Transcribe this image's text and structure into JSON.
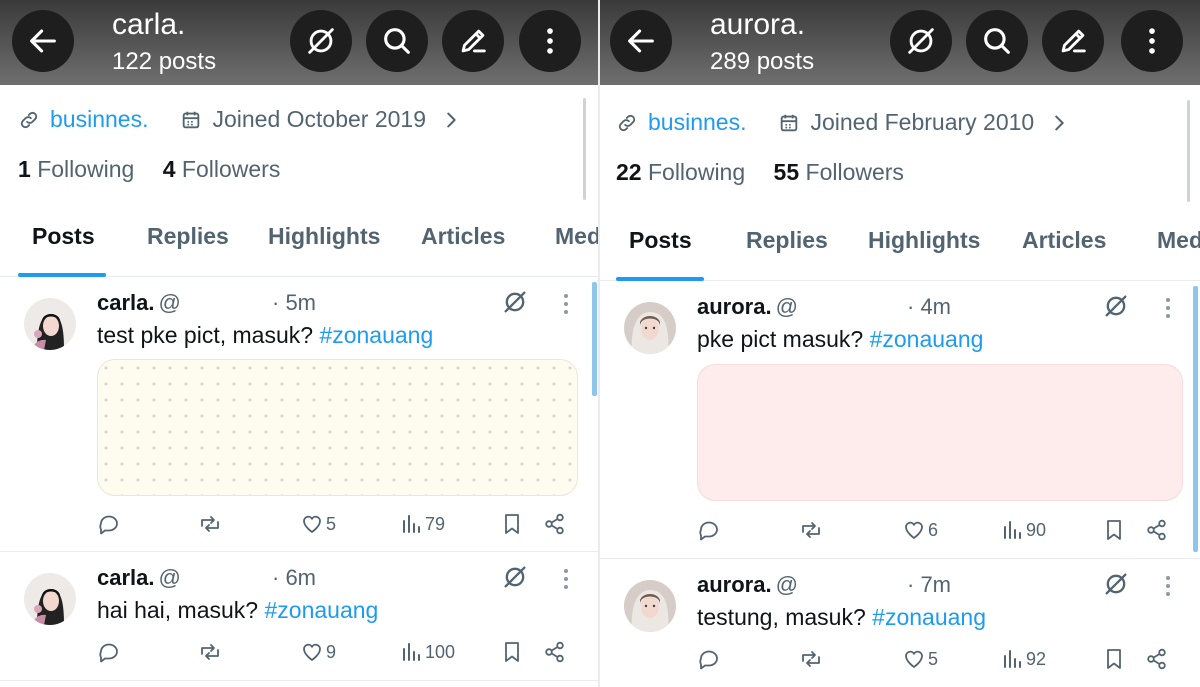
{
  "left": {
    "title": "carla.",
    "post_count": "122 posts",
    "link": "businnes.",
    "joined": "Joined October 2019",
    "following_count": "1",
    "following_label": "Following",
    "followers_count": "4",
    "followers_label": "Followers",
    "tabs": [
      "Posts",
      "Replies",
      "Highlights",
      "Articles",
      "Med"
    ],
    "posts": [
      {
        "name": "carla.",
        "handle": "@",
        "time": "· 5m",
        "text": "test pke pict, masuk?",
        "hashtag": "#zonauang",
        "likes": "5",
        "views": "79"
      },
      {
        "name": "carla.",
        "handle": "@",
        "time": "· 6m",
        "text": "hai hai, masuk?",
        "hashtag": "#zonauang",
        "likes": "9",
        "views": "100"
      }
    ]
  },
  "right": {
    "title": "aurora.",
    "post_count": "289 posts",
    "link": "businnes.",
    "joined": "Joined February 2010",
    "following_count": "22",
    "following_label": "Following",
    "followers_count": "55",
    "followers_label": "Followers",
    "tabs": [
      "Posts",
      "Replies",
      "Highlights",
      "Articles",
      "Med"
    ],
    "posts": [
      {
        "name": "aurora.",
        "handle": "@",
        "time": "· 4m",
        "text": "pke pict masuk?",
        "hashtag": "#zonauang",
        "likes": "6",
        "views": "90"
      },
      {
        "name": "aurora.",
        "handle": "@",
        "time": "· 7m",
        "text": "testung, masuk?",
        "hashtag": "#zonauang",
        "likes": "5",
        "views": "92"
      }
    ]
  },
  "colors": {
    "accent": "#1d9bf0",
    "text": "#0f1419",
    "muted": "#536471",
    "header_button": "#1e1e1e"
  },
  "icons": [
    "back-arrow-icon",
    "grok-icon",
    "search-icon",
    "edit-icon",
    "more-vertical-icon",
    "link-icon",
    "calendar-icon",
    "chevron-right-icon",
    "reply-icon",
    "repost-icon",
    "like-icon",
    "views-icon",
    "bookmark-icon",
    "share-icon"
  ]
}
